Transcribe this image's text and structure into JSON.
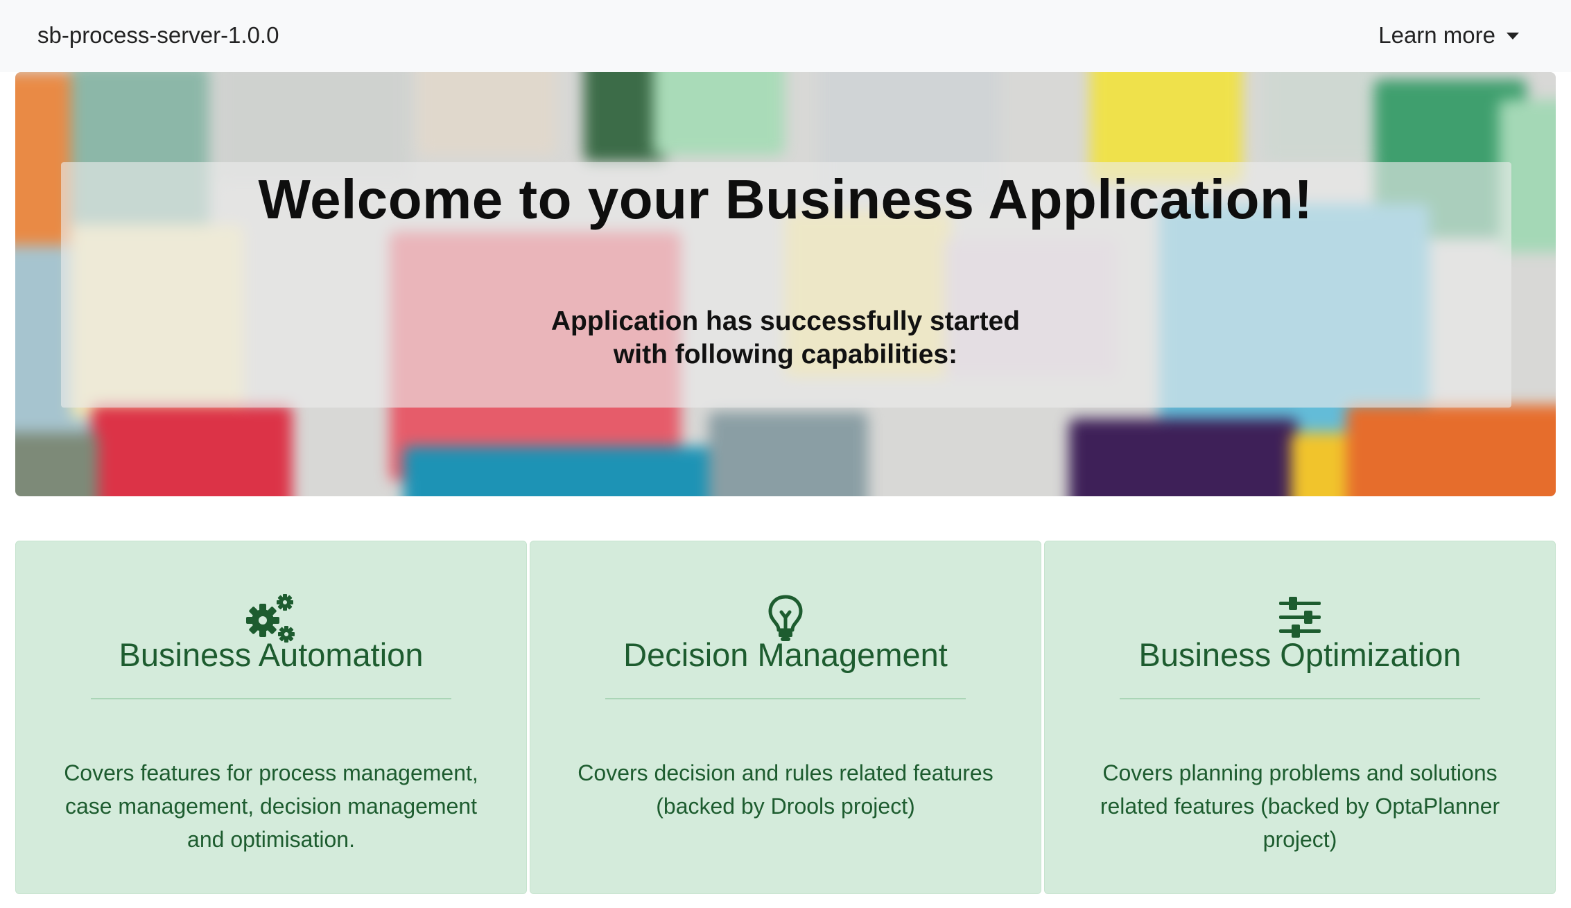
{
  "navbar": {
    "brand": "sb-process-server-1.0.0",
    "learn_more": "Learn more"
  },
  "hero": {
    "title": "Welcome to your Business Application!",
    "subtitle_line1": "Application has successfully started",
    "subtitle_line2": "with following capabilities:"
  },
  "cards": [
    {
      "icon": "gears-icon",
      "title": "Business Automation",
      "description": "Covers features for process management, case management, decision management and optimisation."
    },
    {
      "icon": "lightbulb-icon",
      "title": "Decision Management",
      "description": "Covers decision and rules related features (backed by Drools project)"
    },
    {
      "icon": "sliders-icon",
      "title": "Business Optimization",
      "description": "Covers planning problems and solutions related features (backed by OptaPlanner project)"
    }
  ],
  "colors": {
    "navbar_bg": "#f8f9fa",
    "card_bg": "#d4ebdb",
    "card_text": "#1d5c2f"
  }
}
